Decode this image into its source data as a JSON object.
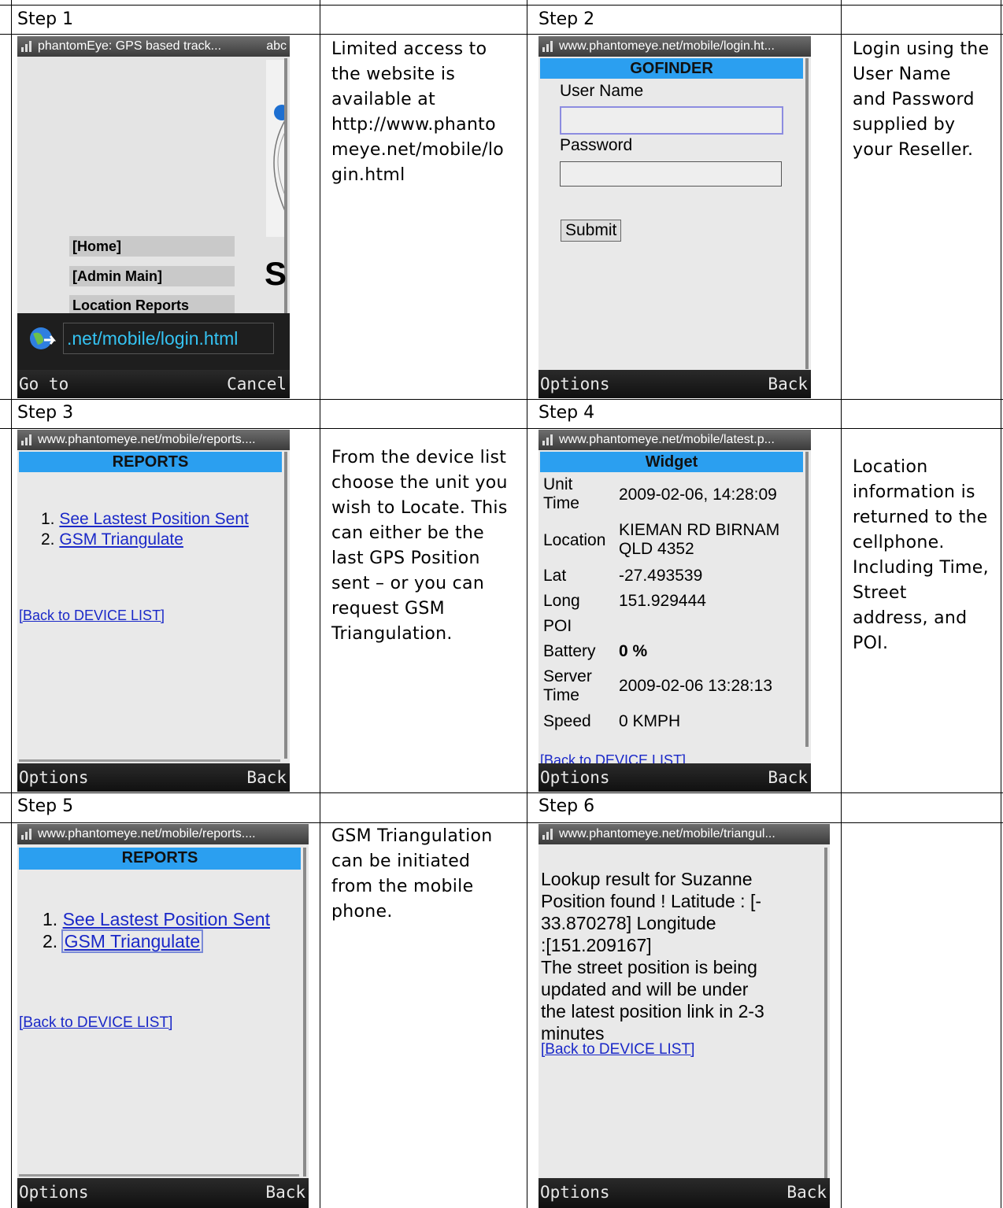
{
  "steps": [
    {
      "label": "Step 1",
      "description": "Limited access to\nthe website is\navailable at\nhttp://www.phanto\nmeye.net/mobile/lo\ngin.html",
      "screen": {
        "status": "phantomEye: GPS based track...",
        "status_right": "abc",
        "menu": [
          "[Home]",
          "[Admin Main]",
          "Location Reports"
        ],
        "big_letter": "S",
        "url": ".net/mobile/login.html",
        "soft_left": "Go to",
        "soft_right": "Cancel"
      }
    },
    {
      "label": "Step 2",
      "description": "Login using the\nUser Name\nand Password\nsupplied by\nyour Reseller.",
      "screen": {
        "status": "www.phantomeye.net/mobile/login.ht...",
        "title": "GOFINDER",
        "username_label": "User Name",
        "password_label": "Password",
        "submit": "Submit",
        "soft_left": "Options",
        "soft_right": "Back"
      }
    },
    {
      "label": "Step 3",
      "description": "From the device list\nchoose the unit you\nwish to Locate.  This\ncan either be the\nlast GPS Position\nsent – or you can\nrequest GSM\nTriangulation.",
      "screen": {
        "status": "www.phantomeye.net/mobile/reports....",
        "title": "REPORTS",
        "items": [
          "See Lastest Position Sent",
          "GSM Triangulate"
        ],
        "back_link": "[Back to DEVICE LIST]",
        "soft_left": "Options",
        "soft_right": "Back"
      }
    },
    {
      "label": "Step 4",
      "description": "Location\ninformation is\nreturned to the\ncellphone.\nIncluding Time,\nStreet\naddress, and\nPOI.",
      "screen": {
        "status": "www.phantomeye.net/mobile/latest.p...",
        "title": "Widget",
        "rows": [
          {
            "k": "Unit\nTime",
            "v": "2009-02-06, 14:28:09"
          },
          {
            "k": "Location",
            "v": "KIEMAN RD BIRNAM\nQLD 4352"
          },
          {
            "k": "Lat",
            "v": "-27.493539"
          },
          {
            "k": "Long",
            "v": "151.929444"
          },
          {
            "k": "POI",
            "v": ""
          },
          {
            "k": "Battery",
            "v": "0 %"
          },
          {
            "k": "Server\nTime",
            "v": "2009-02-06 13:28:13"
          },
          {
            "k": "Speed",
            "v": "0 KMPH"
          }
        ],
        "back_link": "[Back to DEVICE LIST]",
        "soft_left": "Options",
        "soft_right": "Back"
      }
    },
    {
      "label": "Step 5",
      "description": "GSM Triangulation\ncan be initiated\nfrom the mobile\nphone.",
      "screen": {
        "status": "www.phantomeye.net/mobile/reports....",
        "title": "REPORTS",
        "items": [
          "See Lastest Position Sent",
          "GSM Triangulate"
        ],
        "back_link": "[Back to DEVICE LIST]",
        "soft_left": "Options",
        "soft_right": "Back"
      }
    },
    {
      "label": "Step 6",
      "description": "",
      "screen": {
        "status": "www.phantomeye.net/mobile/triangul...",
        "result": "Lookup result for Suzanne\nPosition found ! Latitude : [-\n33.870278] Longitude\n:[151.209167]\nThe street position is being\nupdated and will be under\nthe latest position link in 2-3\nminutes",
        "back_link": "[Back to DEVICE LIST]",
        "soft_left": "Options",
        "soft_right": "Back"
      }
    }
  ]
}
